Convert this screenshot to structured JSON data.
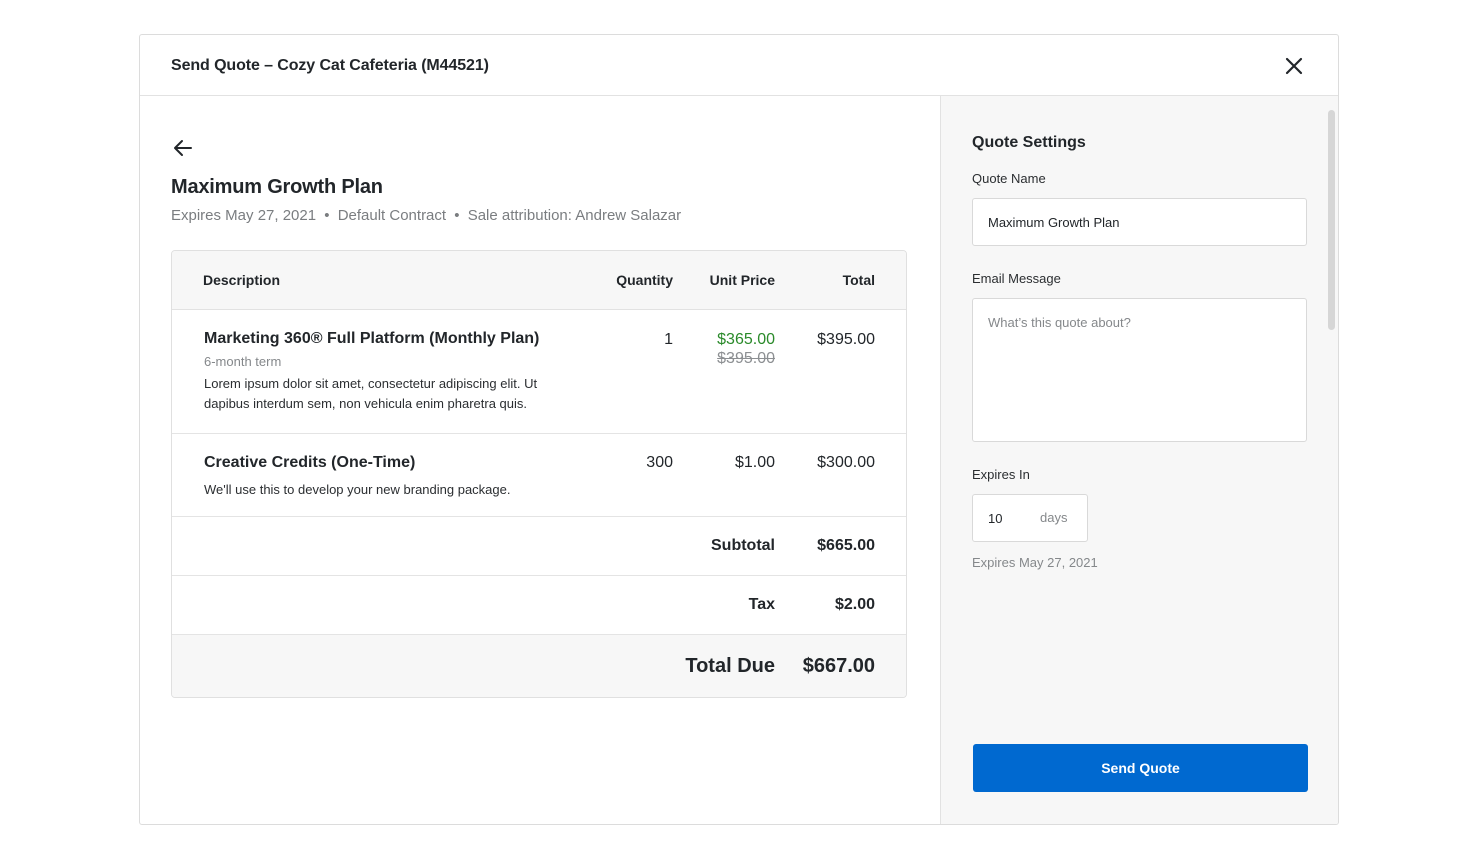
{
  "modal": {
    "title": "Send Quote – Cozy Cat Cafeteria (M44521)"
  },
  "quote": {
    "title": "Maximum Growth Plan",
    "meta": {
      "expires": "Expires May 27, 2021",
      "contract": "Default Contract",
      "attribution": "Sale attribution: Andrew Salazar",
      "separator": "•"
    }
  },
  "table": {
    "headers": {
      "description": "Description",
      "quantity": "Quantity",
      "unit_price": "Unit Price",
      "total": "Total"
    },
    "items": [
      {
        "name": "Marketing 360® Full Platform (Monthly Plan)",
        "term": "6-month term",
        "description": "Lorem ipsum dolor sit amet, consectetur adipiscing elit. Ut dapibus interdum sem, non vehicula enim pharetra quis.",
        "quantity": "1",
        "unit_price": "$365.00",
        "original_price": "$395.00",
        "total": "$395.00"
      },
      {
        "name": "Creative Credits (One-Time)",
        "description": "We'll use this to develop your new branding package.",
        "quantity": "300",
        "unit_price": "$1.00",
        "total": "$300.00"
      }
    ],
    "subtotal": {
      "label": "Subtotal",
      "value": "$665.00"
    },
    "tax": {
      "label": "Tax",
      "value": "$2.00"
    },
    "total_due": {
      "label": "Total Due",
      "value": "$667.00"
    }
  },
  "settings": {
    "title": "Quote Settings",
    "quote_name_label": "Quote Name",
    "quote_name_value": "Maximum Growth Plan",
    "email_message_label": "Email Message",
    "email_message_placeholder": "What’s this quote about?",
    "expires_in_label": "Expires In",
    "expires_in_value": "10",
    "expires_in_unit": "days",
    "expires_note": "Expires May 27, 2021",
    "send_button": "Send Quote"
  },
  "colors": {
    "primary": "#0069d0",
    "discount_green": "#2a8a2a",
    "panel_bg": "#f7f7f7"
  },
  "icons": {
    "close": "close-icon",
    "back": "arrow-left-icon"
  }
}
